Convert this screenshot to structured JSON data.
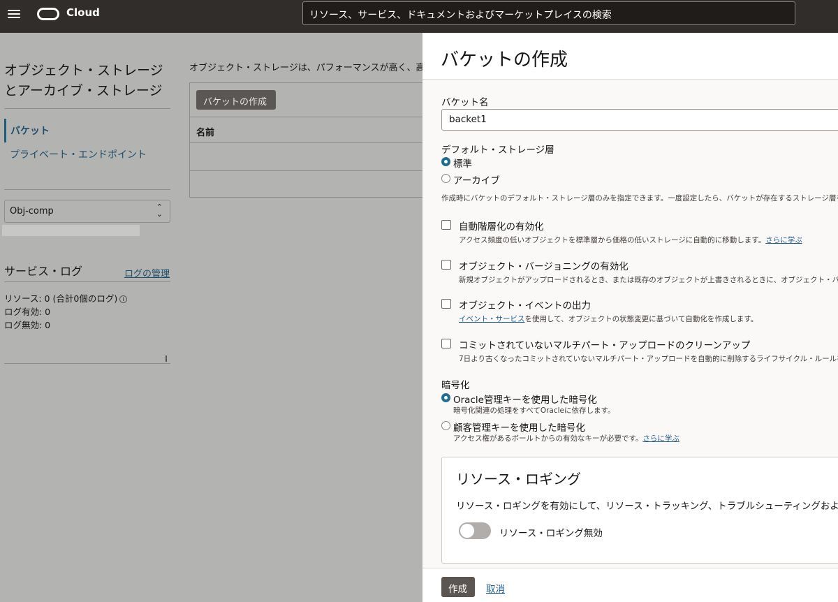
{
  "header": {
    "brand": "Cloud",
    "search_placeholder": "リソース、サービス、ドキュメントおよびマーケットプレイスの検索"
  },
  "sidebar": {
    "title": "オブジェクト・ストレージとアーカイブ・ストレージ",
    "items": [
      {
        "label": "バケット",
        "active": true
      },
      {
        "label": "プライベート・エンドポイント",
        "active": false
      }
    ],
    "compartment": "Obj-comp",
    "service_logs": {
      "title": "サービス・ログ",
      "manage_link": "ログの管理",
      "resources": "リソース:  0 (合計0個のログ)",
      "enabled": "ログ有効:  0",
      "disabled": "ログ無効:  0"
    }
  },
  "main": {
    "description": "オブジェクト・ストレージは、パフォーマンスが高く、高",
    "create_button": "バケットの作成",
    "column_name": "名前"
  },
  "panel": {
    "title": "バケットの作成",
    "bucket_name_label": "バケット名",
    "bucket_name_value": "backet1",
    "storage_tier": {
      "label": "デフォルト・ストレージ層",
      "options": [
        "標準",
        "アーカイブ"
      ],
      "selected": "標準",
      "help": "作成時にバケットのデフォルト・ストレージ層のみを指定できます。一度設定したら、バケットが存在するストレージ層を"
    },
    "auto_tiering": {
      "label": "自動階層化の有効化",
      "help": "アクセス頻度の低いオブジェクトを標準層から価格の低いストレージに自動的に移動します。",
      "link": "さらに学ぶ",
      "checked": false
    },
    "versioning": {
      "label": "オブジェクト・バージョニングの有効化",
      "help": "新規オブジェクトがアップロードされるとき、または既存のオブジェクトが上書きされるときに、オブジェクト・バ",
      "checked": false
    },
    "events": {
      "label": "オブジェクト・イベントの出力",
      "link": "イベント・サービス",
      "help": "を使用して、オブジェクトの状態変更に基づいて自動化を作成します。",
      "checked": false
    },
    "multipart_cleanup": {
      "label": "コミットされていないマルチパート・アップロードのクリーンアップ",
      "help": "7日より古くなったコミットされていないマルチパート・アップロードを自動的に削除するライフサイクル・ルールを",
      "checked": false
    },
    "encryption": {
      "label": "暗号化",
      "oracle_label": "Oracle管理キーを使用した暗号化",
      "oracle_help": "暗号化関連の処理をすべてOracleに依存します。",
      "customer_label": "顧客管理キーを使用した暗号化",
      "customer_help": "アクセス権があるボールトからの有効なキーが必要です。",
      "customer_link": "さらに学ぶ",
      "selected": "Oracle管理キーを使用した暗号化"
    },
    "logging": {
      "title": "リソース・ロギング",
      "description": "リソース・ロギングを有効にして、リソース・トラッキング、トラブルシューティングおよ",
      "toggle_label": "リソース・ロギング無効",
      "enabled": false
    },
    "footer": {
      "create": "作成",
      "cancel": "取消"
    }
  }
}
